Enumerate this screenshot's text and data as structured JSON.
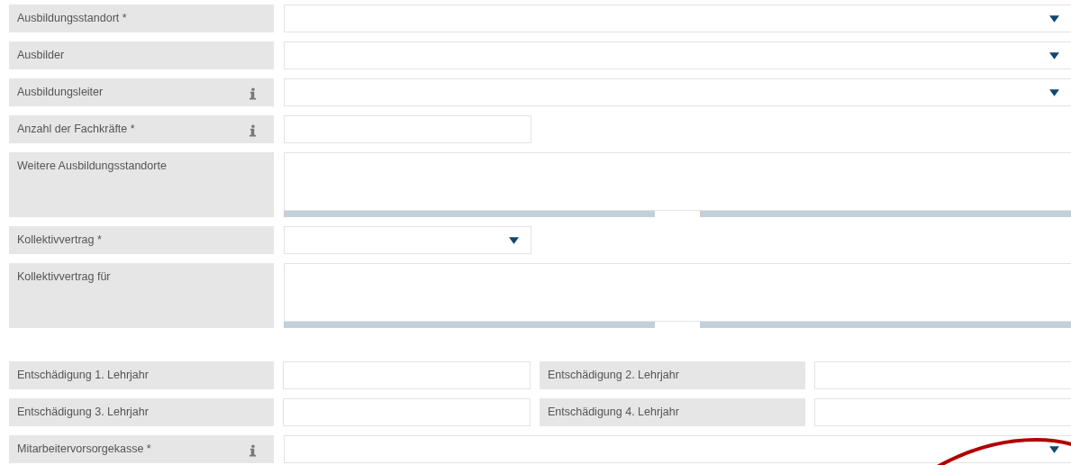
{
  "form": {
    "rows": [
      {
        "kind": "select",
        "label": "Ausbildungsstandort *",
        "info": false
      },
      {
        "kind": "select",
        "label": "Ausbilder",
        "info": false
      },
      {
        "kind": "select",
        "label": "Ausbildungsleiter",
        "info": true
      },
      {
        "kind": "text-short",
        "label": "Anzahl der Fachkräfte *",
        "info": true
      },
      {
        "kind": "textarea",
        "label": "Weitere Ausbildungsstandorte",
        "info": false
      },
      {
        "kind": "select-short",
        "label": "Kollektivvertrag *",
        "info": false
      },
      {
        "kind": "textarea",
        "label": "Kollektivvertrag für",
        "info": false
      },
      {
        "kind": "spacer"
      },
      {
        "kind": "pair",
        "label": "Entschädigung 1. Lehrjahr",
        "label_2": "Entschädigung 2. Lehrjahr"
      },
      {
        "kind": "pair",
        "label": "Entschädigung 3. Lehrjahr",
        "label_2": "Entschädigung 4. Lehrjahr"
      },
      {
        "kind": "select",
        "label": "Mitarbeitervorsorgekasse *",
        "info": true
      }
    ]
  }
}
